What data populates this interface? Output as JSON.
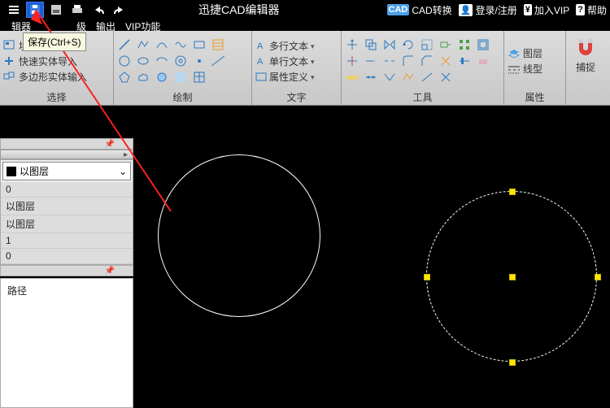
{
  "titlebar": {
    "title": "迅捷CAD编辑器",
    "right": {
      "cad_convert": "CAD转换",
      "login": "登录/注册",
      "vip": "加入VIP",
      "help": "帮助"
    }
  },
  "tooltip": {
    "save": "保存(Ctrl+S)"
  },
  "tabs": {
    "editor": "辑器",
    "adv": "级",
    "output": "输出",
    "vipfn": "VIP功能"
  },
  "ribbon": {
    "select": {
      "block_edit": "块编辑器",
      "quick_import": "快速实体导入",
      "polygon_input": "多边形实体输入",
      "label": "选择"
    },
    "draw": {
      "label": "绘制"
    },
    "text": {
      "multiline": "多行文本",
      "singleline": "单行文本",
      "propdef": "属性定义",
      "label": "文字"
    },
    "tools": {
      "label": "工具"
    },
    "props": {
      "layer": "图层",
      "linetype": "线型",
      "label": "属性"
    },
    "snap": {
      "label": "捕捉"
    }
  },
  "side": {
    "bylayer": "以图层",
    "rows": [
      "0",
      "以图层",
      "以图层",
      "1",
      "0"
    ],
    "path_label": "路径"
  }
}
